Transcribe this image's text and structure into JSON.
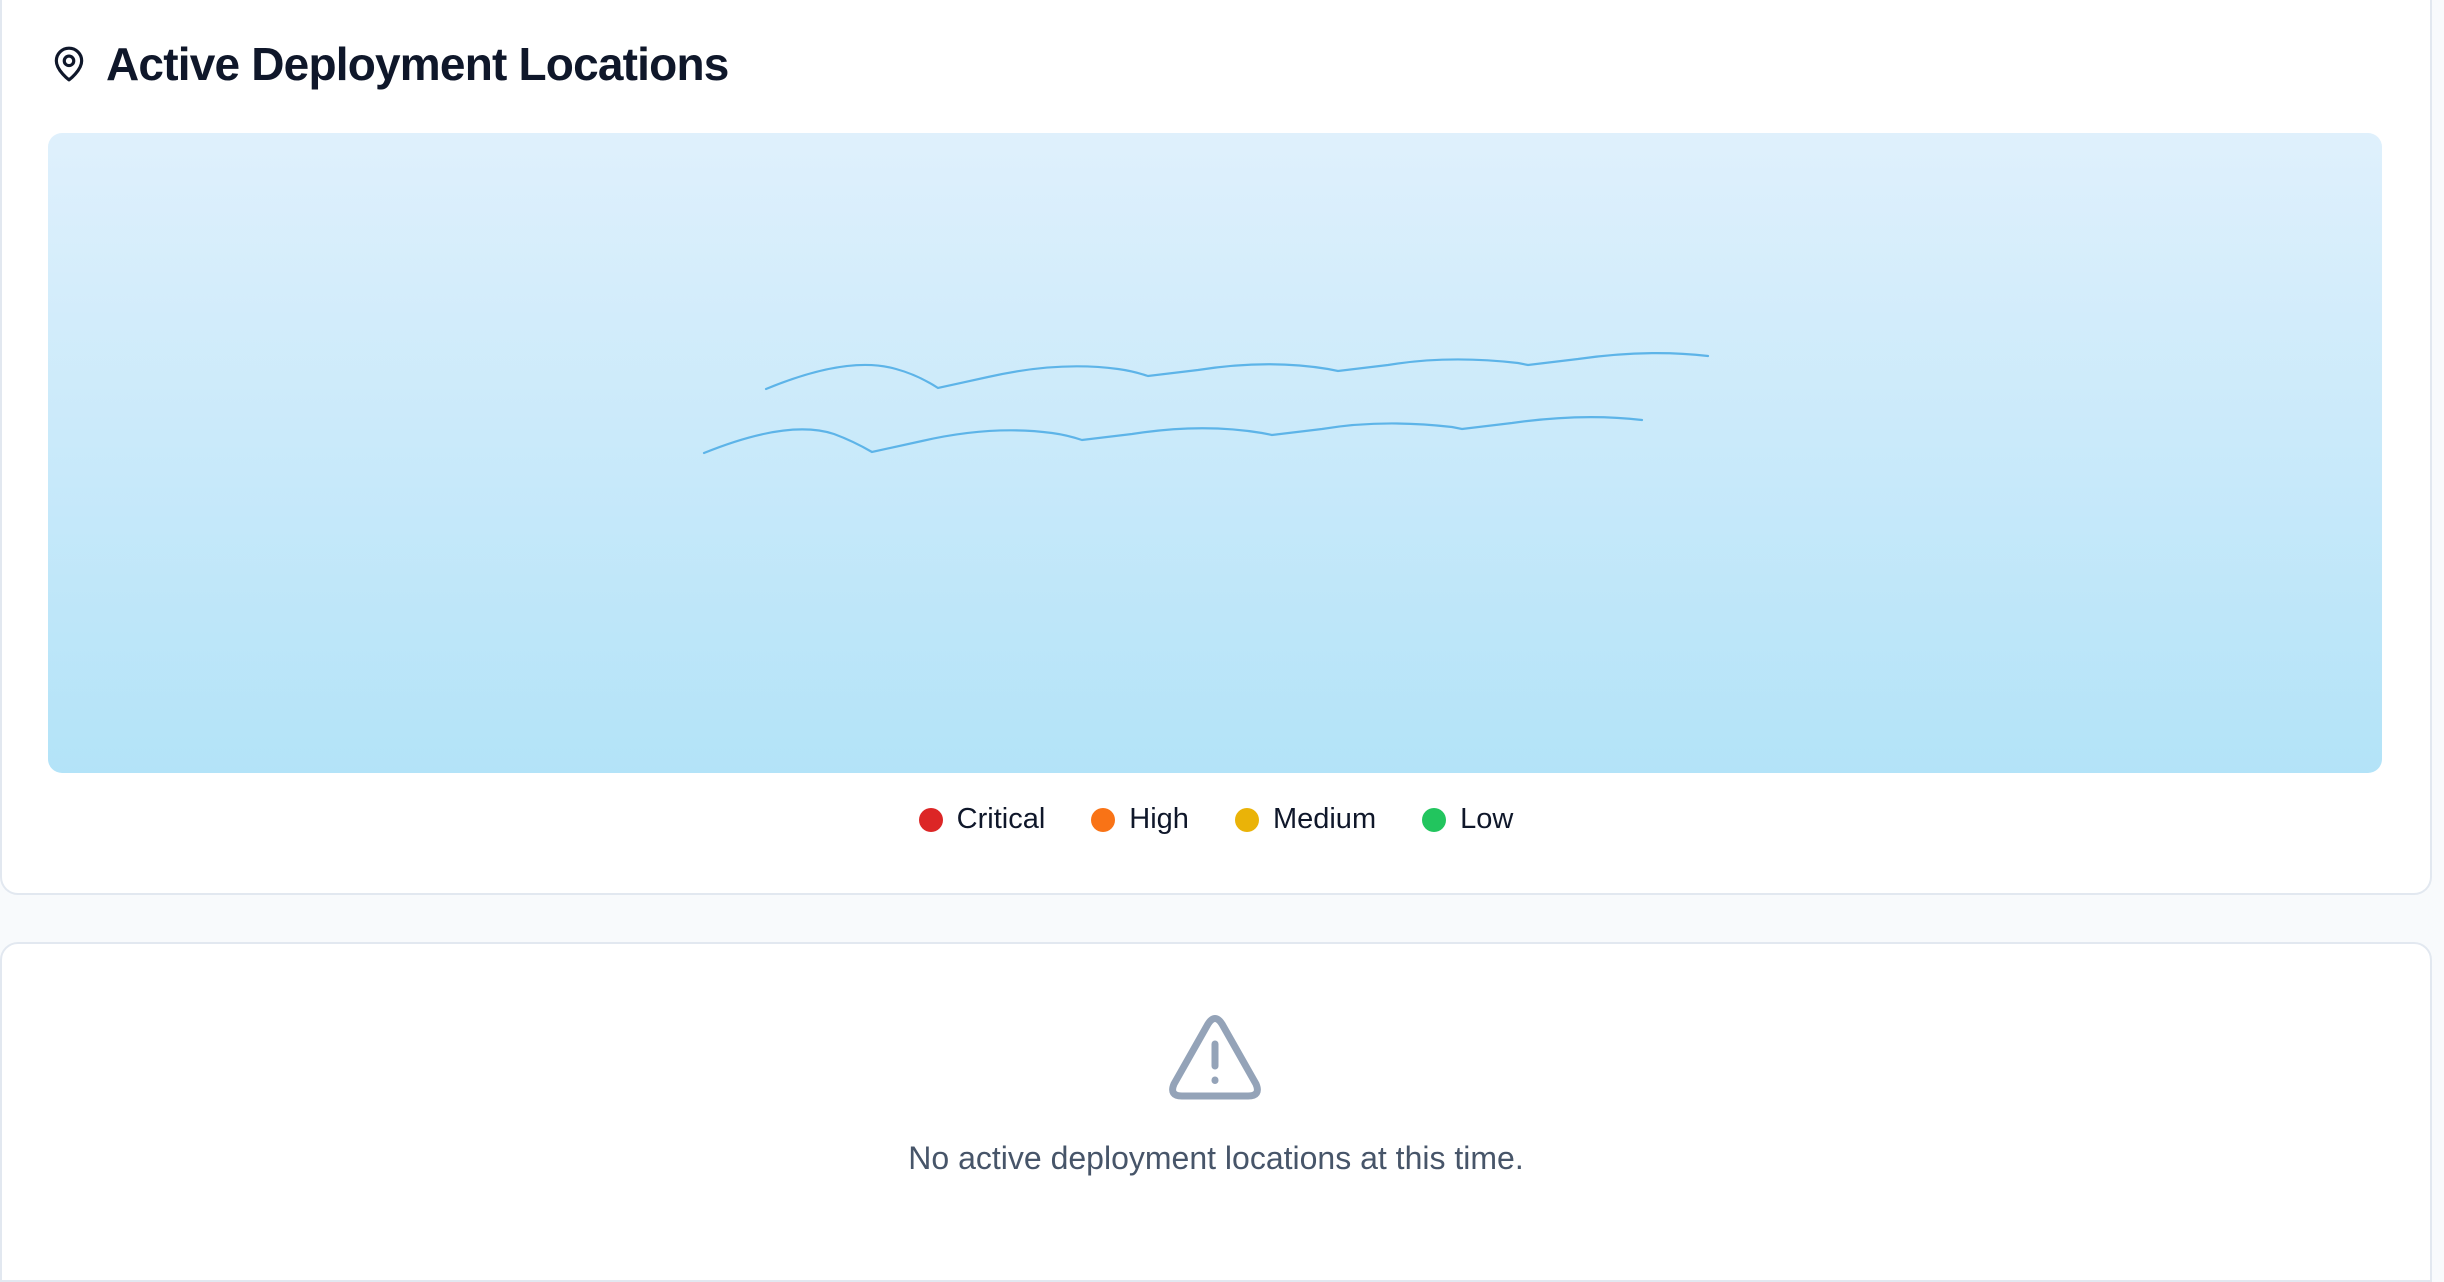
{
  "map_panel": {
    "title": "Active Deployment Locations",
    "title_icon": "map-pin-icon",
    "legend": [
      {
        "label": "Critical",
        "color": "#dc2626"
      },
      {
        "label": "High",
        "color": "#f97316"
      },
      {
        "label": "Medium",
        "color": "#eab308"
      },
      {
        "label": "Low",
        "color": "#22c55e"
      }
    ],
    "wave_color": "#5db4e8"
  },
  "empty_panel": {
    "icon": "warning-triangle-icon",
    "message": "No active deployment locations at this time."
  }
}
